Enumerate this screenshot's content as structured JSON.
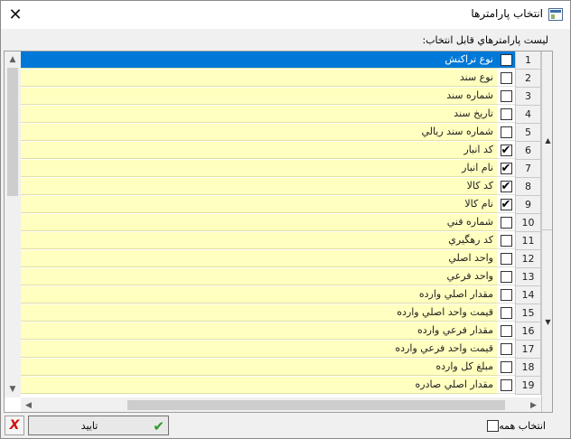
{
  "window": {
    "title": "انتخاب پارامترها"
  },
  "list_caption": "ليست پارامترهاي قابل انتخاب:",
  "rows": [
    {
      "num": "1",
      "name": "نوع تراكنش",
      "checked": false,
      "selected": true
    },
    {
      "num": "2",
      "name": "نوع سند",
      "checked": false
    },
    {
      "num": "3",
      "name": "شماره سند",
      "checked": false
    },
    {
      "num": "4",
      "name": "تاريخ سند",
      "checked": false
    },
    {
      "num": "5",
      "name": "شماره سند ريالي",
      "checked": false
    },
    {
      "num": "6",
      "name": "كد انبار",
      "checked": true
    },
    {
      "num": "7",
      "name": "نام انبار",
      "checked": true
    },
    {
      "num": "8",
      "name": "كد كالا",
      "checked": true
    },
    {
      "num": "9",
      "name": "نام كالا",
      "checked": true
    },
    {
      "num": "10",
      "name": "شماره فني",
      "checked": false
    },
    {
      "num": "11",
      "name": "كد رهگيري",
      "checked": false
    },
    {
      "num": "12",
      "name": "واحد اصلي",
      "checked": false
    },
    {
      "num": "13",
      "name": "واحد فرعي",
      "checked": false
    },
    {
      "num": "14",
      "name": "مقدار اصلي وارده",
      "checked": false
    },
    {
      "num": "15",
      "name": "قيمت واحد اصلي وارده",
      "checked": false
    },
    {
      "num": "16",
      "name": "مقدار فرعي وارده",
      "checked": false
    },
    {
      "num": "17",
      "name": "قيمت واحد فرعي وارده",
      "checked": false
    },
    {
      "num": "18",
      "name": "مبلغ كل وارده",
      "checked": false
    },
    {
      "num": "19",
      "name": "مقدار اصلي صادره",
      "checked": false
    }
  ],
  "footer": {
    "confirm_label": "تاييد",
    "select_all_label": "انتخاب همه",
    "select_all_checked": false
  },
  "icons": {
    "close": "close-icon",
    "cancel": "cancel-x-icon",
    "confirm": "checkmark-icon"
  },
  "colors": {
    "row_bg": "#ffffc0",
    "selected_bg": "#0078d7",
    "confirm_icon": "#2a9a2a",
    "cancel_icon": "#d01010"
  }
}
